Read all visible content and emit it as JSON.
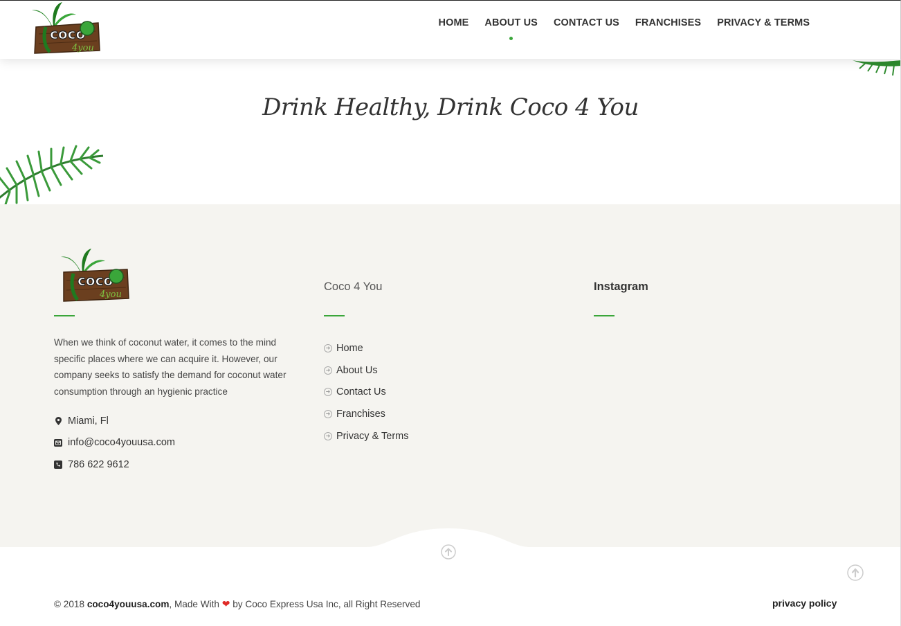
{
  "header": {
    "logo_text": "coco 4 you",
    "nav": [
      {
        "label": "HOME",
        "active": false
      },
      {
        "label": "ABOUT US",
        "active": true
      },
      {
        "label": "CONTACT US",
        "active": false
      },
      {
        "label": "FRANCHISES",
        "active": false
      },
      {
        "label": "PRIVACY & TERMS",
        "active": false
      }
    ]
  },
  "hero": {
    "tagline": "Drink Healthy, Drink Coco 4 You"
  },
  "footer": {
    "about": {
      "logo_text": "coco 4 you",
      "text": "When we think of coconut water, it comes to the mind specific places where we can acquire it. However, our company seeks to satisfy the demand for coconut water consumption through an hygienic practice",
      "location": "Miami, Fl",
      "email": "info@coco4youusa.com",
      "phone": "786 622 9612"
    },
    "links_col": {
      "title": "Coco 4 You",
      "items": [
        "Home",
        "About Us",
        "Contact Us",
        "Franchises",
        "Privacy & Terms"
      ]
    },
    "instagram_col": {
      "title": "Instagram"
    }
  },
  "bottom": {
    "copyright_prefix": "© 2018 ",
    "site": "coco4youusa.com",
    "made_with": ", Made With ",
    "copyright_suffix": " by Coco Express Usa Inc, all Right Reserved",
    "privacy": "privacy policy"
  },
  "colors": {
    "accent": "#3aa63a",
    "footer_bg": "#f5f4f0",
    "heart": "#e02b27"
  }
}
